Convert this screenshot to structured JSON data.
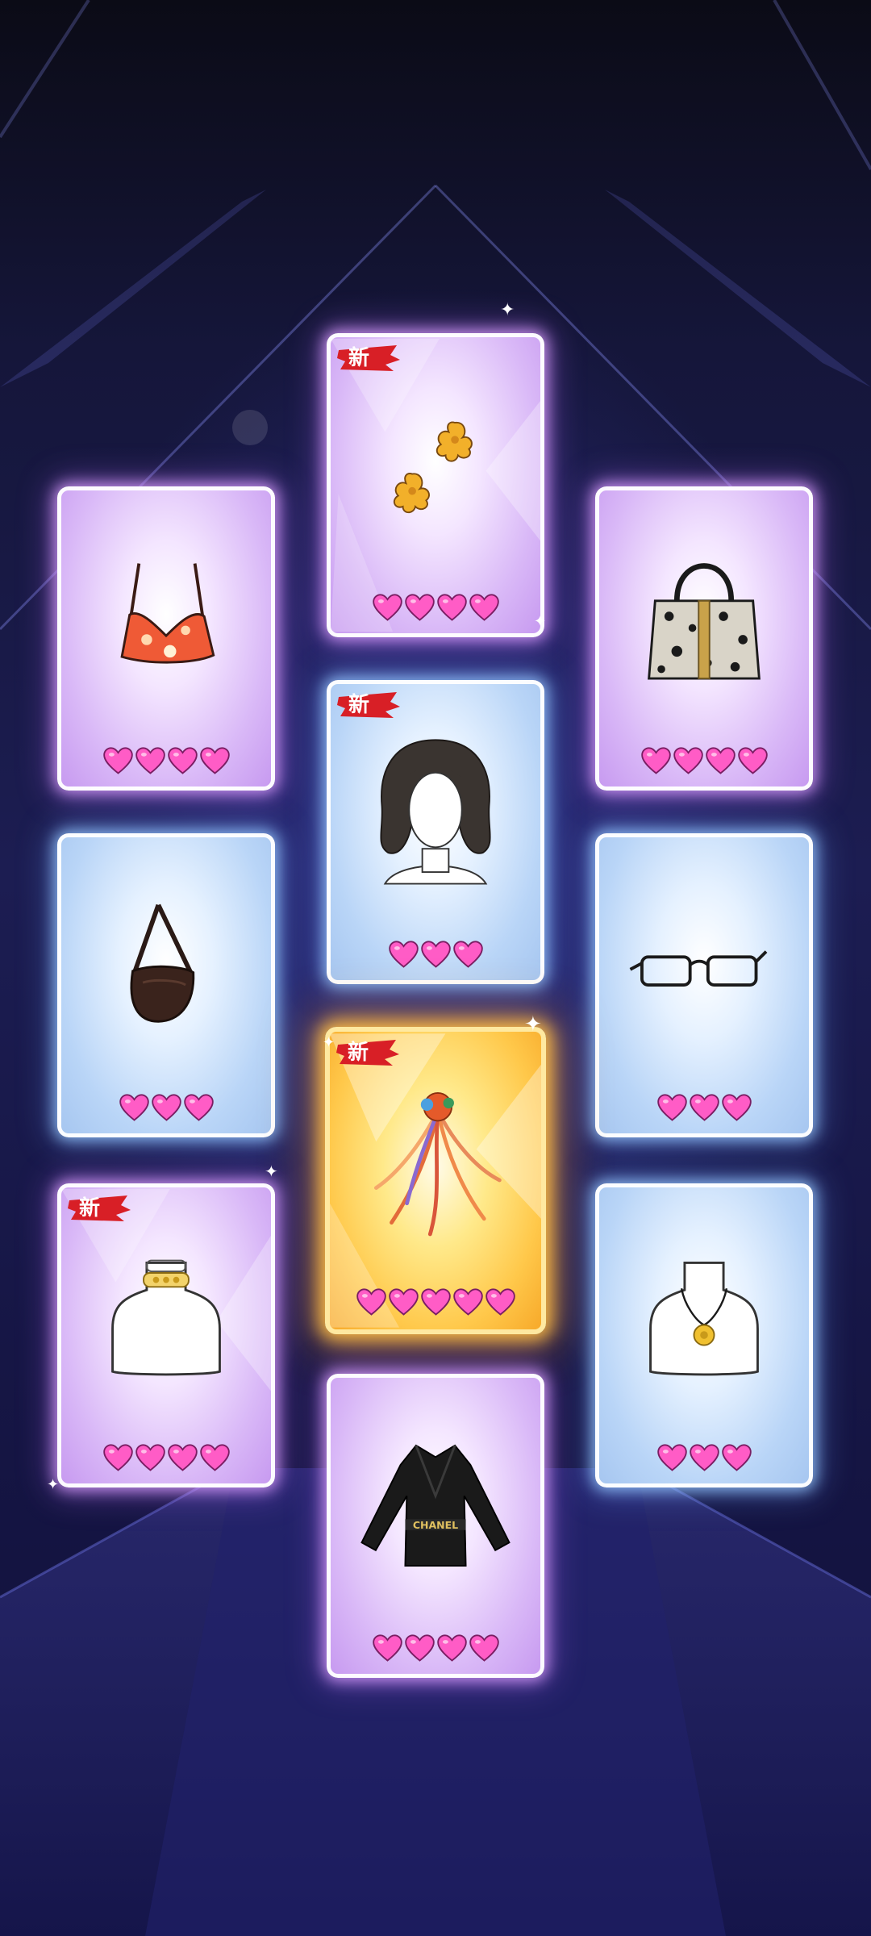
{
  "new_badge_text": "新",
  "colors": {
    "heart_fill": "#ff5cc6",
    "heart_stroke": "#7a1e63",
    "badge_red": "#d81f26"
  },
  "cards": [
    {
      "id": "earrings",
      "item": "flower-earrings",
      "rarity_color": "purple",
      "hearts": 4,
      "is_new": true
    },
    {
      "id": "crop-top",
      "item": "floral-crop-top",
      "rarity_color": "purple",
      "hearts": 4,
      "is_new": false
    },
    {
      "id": "handbag",
      "item": "leopard-handbag",
      "rarity_color": "purple",
      "hearts": 4,
      "is_new": false
    },
    {
      "id": "hair",
      "item": "bob-hairstyle",
      "rarity_color": "blue",
      "hearts": 3,
      "is_new": true
    },
    {
      "id": "shoulder-bag",
      "item": "brown-shoulder-bag",
      "rarity_color": "blue",
      "hearts": 3,
      "is_new": false
    },
    {
      "id": "glasses",
      "item": "black-glasses",
      "rarity_color": "blue",
      "hearts": 3,
      "is_new": false
    },
    {
      "id": "headdress",
      "item": "ribbon-headdress",
      "rarity_color": "gold",
      "hearts": 5,
      "is_new": true
    },
    {
      "id": "choker",
      "item": "gold-choker",
      "rarity_color": "purple",
      "hearts": 4,
      "is_new": true
    },
    {
      "id": "pendant",
      "item": "gold-pendant-necklace",
      "rarity_color": "blue",
      "hearts": 3,
      "is_new": false
    },
    {
      "id": "jacket",
      "item": "black-jacket",
      "rarity_color": "purple",
      "hearts": 4,
      "is_new": false,
      "print": "CHANEL"
    }
  ]
}
